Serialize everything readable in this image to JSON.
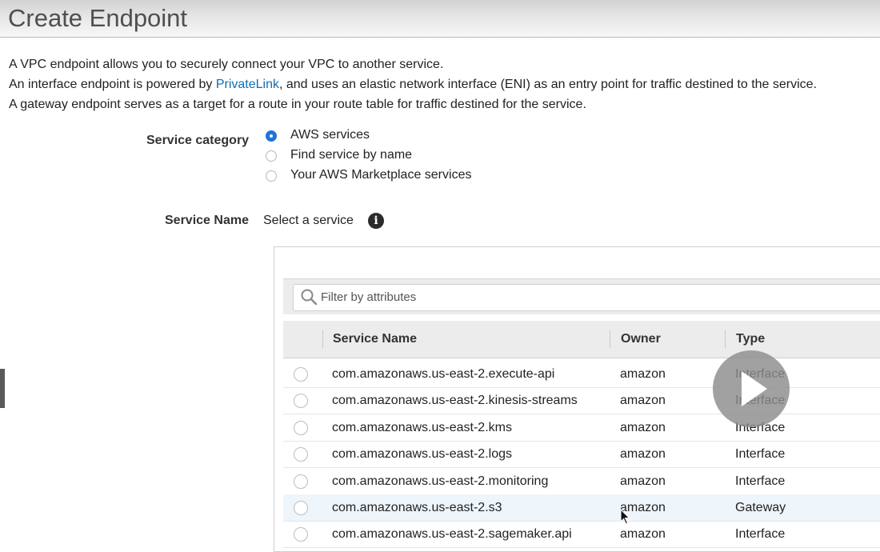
{
  "page": {
    "title": "Create Endpoint"
  },
  "description": {
    "line1": "A VPC endpoint allows you to securely connect your VPC to another service.",
    "line2_before": "An interface endpoint is powered by ",
    "line2_link": "PrivateLink",
    "line2_after": ", and uses an elastic network interface (ENI) as an entry point for traffic destined to the service.",
    "line3": "A gateway endpoint serves as a target for a route in your route table for traffic destined for the service."
  },
  "service_category": {
    "label": "Service category",
    "options": [
      {
        "label": "AWS services",
        "selected": true
      },
      {
        "label": "Find service by name",
        "selected": false
      },
      {
        "label": "Your AWS Marketplace services",
        "selected": false
      }
    ]
  },
  "service_name": {
    "label": "Service Name",
    "value": "Select a service",
    "info_icon": "info-icon"
  },
  "filter": {
    "placeholder": "Filter by attributes",
    "icon": "search-icon"
  },
  "table": {
    "columns": [
      "Service Name",
      "Owner",
      "Type"
    ],
    "rows": [
      {
        "service": "com.amazonaws.us-east-2.execute-api",
        "owner": "amazon",
        "type": "Interface"
      },
      {
        "service": "com.amazonaws.us-east-2.kinesis-streams",
        "owner": "amazon",
        "type": "Interface"
      },
      {
        "service": "com.amazonaws.us-east-2.kms",
        "owner": "amazon",
        "type": "Interface"
      },
      {
        "service": "com.amazonaws.us-east-2.logs",
        "owner": "amazon",
        "type": "Interface"
      },
      {
        "service": "com.amazonaws.us-east-2.monitoring",
        "owner": "amazon",
        "type": "Interface"
      },
      {
        "service": "com.amazonaws.us-east-2.s3",
        "owner": "amazon",
        "type": "Gateway"
      },
      {
        "service": "com.amazonaws.us-east-2.sagemaker.api",
        "owner": "amazon",
        "type": "Interface"
      }
    ],
    "highlighted_row": 5
  },
  "colors": {
    "accent": "#1f74d6",
    "link": "#0f6fb4",
    "highlight_row": "#eef5fb"
  }
}
